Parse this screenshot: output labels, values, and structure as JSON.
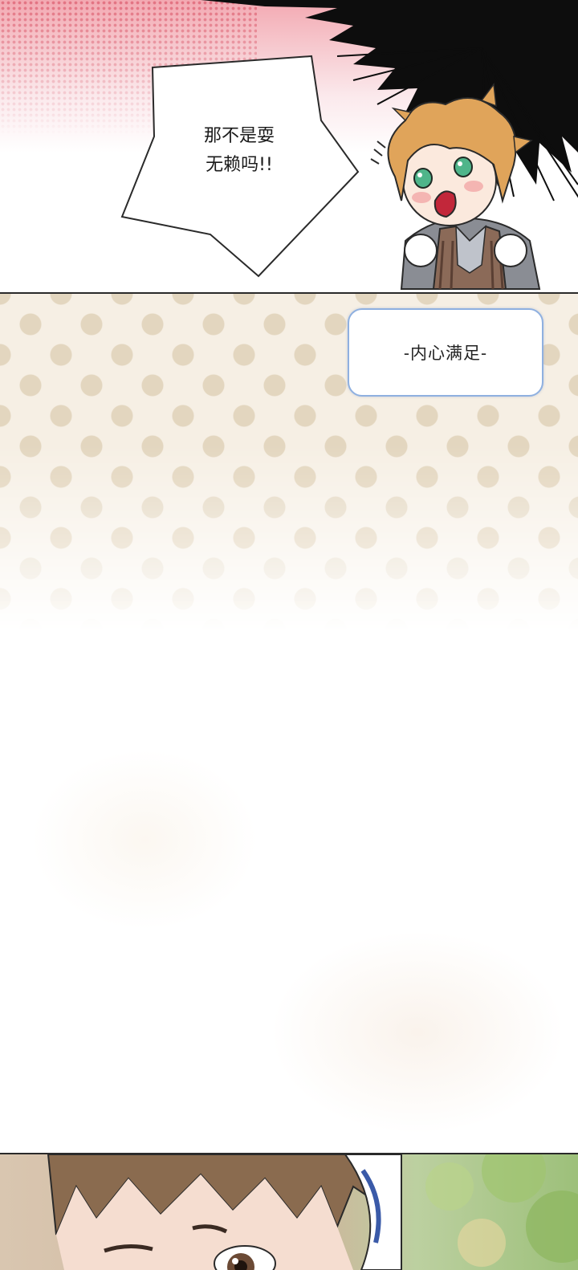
{
  "panels": [
    {
      "speech_bubble": {
        "lines": [
          "那不是耍",
          "无赖吗!!"
        ]
      },
      "character": "chibi-blond-boy-shouting"
    },
    {
      "caption": {
        "text": "-内心满足-"
      },
      "background": "polka-dot-beige-fading-white"
    },
    {
      "character": "brown-haired-boy-closeup"
    }
  ],
  "colors": {
    "background_pink": "#f3a9b2",
    "speech_outline": "#2a2a2a",
    "caption_border": "#8fb0e0",
    "dot_color": "#e3d6bf",
    "dot_background": "#f6efe4",
    "hair_blond": "#e0a45a",
    "eye_green": "#4fb58a"
  }
}
